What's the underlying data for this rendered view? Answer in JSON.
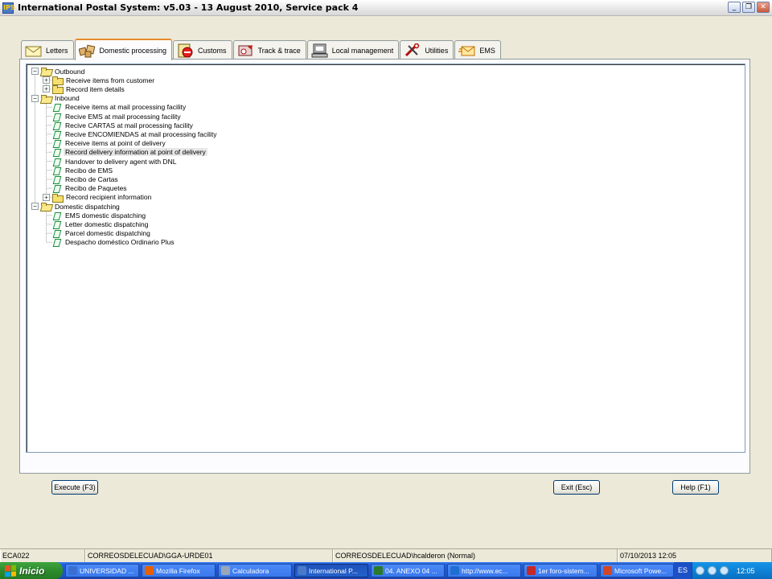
{
  "window": {
    "title": "International Postal System: v5.03 - 13 August 2010, Service pack 4",
    "app_icon_text": "IPS",
    "minimize": "_",
    "restore": "❐",
    "close": "✕"
  },
  "tabs": [
    {
      "label": "Letters",
      "icon": "envelope-icon"
    },
    {
      "label": "Domestic processing",
      "icon": "parcels-icon"
    },
    {
      "label": "Customs",
      "icon": "customs-icon"
    },
    {
      "label": "Track & trace",
      "icon": "track-icon"
    },
    {
      "label": "Local management",
      "icon": "computer-icon"
    },
    {
      "label": "Utilities",
      "icon": "tools-icon"
    },
    {
      "label": "EMS",
      "icon": "ems-icon"
    }
  ],
  "active_tab": "Domestic processing",
  "tree": {
    "nodes": [
      {
        "label": "Outbound",
        "level": 0,
        "type": "folder",
        "expander": "−"
      },
      {
        "label": "Receive items from customer",
        "level": 1,
        "type": "folder",
        "expander": "+"
      },
      {
        "label": "Record item details",
        "level": 1,
        "type": "folder",
        "expander": "+"
      },
      {
        "label": "Inbound",
        "level": 0,
        "type": "folder",
        "expander": "−"
      },
      {
        "label": "Receive items at mail processing facility",
        "level": 1,
        "type": "leaf"
      },
      {
        "label": "Recive EMS at mail processing facility",
        "level": 1,
        "type": "leaf"
      },
      {
        "label": "Recive CARTAS at mail processing facility",
        "level": 1,
        "type": "leaf"
      },
      {
        "label": "Recive ENCOMIENDAS at mail processing facility",
        "level": 1,
        "type": "leaf"
      },
      {
        "label": "Receive items at point of delivery",
        "level": 1,
        "type": "leaf"
      },
      {
        "label": "Record delivery information at point of delivery",
        "level": 1,
        "type": "leaf",
        "selected": true
      },
      {
        "label": "Handover to delivery agent with DNL",
        "level": 1,
        "type": "leaf"
      },
      {
        "label": "Recibo de EMS",
        "level": 1,
        "type": "leaf"
      },
      {
        "label": "Recibo de Cartas",
        "level": 1,
        "type": "leaf"
      },
      {
        "label": "Recibo de Paquetes",
        "level": 1,
        "type": "leaf"
      },
      {
        "label": "Record recipient information",
        "level": 1,
        "type": "folder",
        "expander": "+"
      },
      {
        "label": "Domestic dispatching",
        "level": 0,
        "type": "folder",
        "expander": "−"
      },
      {
        "label": "EMS domestic dispatching",
        "level": 1,
        "type": "leaf"
      },
      {
        "label": "Letter domestic dispatching",
        "level": 1,
        "type": "leaf"
      },
      {
        "label": "Parcel domestic dispatching",
        "level": 1,
        "type": "leaf"
      },
      {
        "label": "Despacho doméstico Ordinario Plus",
        "level": 1,
        "type": "leaf"
      }
    ]
  },
  "buttons": {
    "execute": "Execute (F3)",
    "exit": "Exit (Esc)",
    "help": "Help (F1)"
  },
  "status": {
    "code": "ECA022",
    "office": "CORREOSDELECUAD\\GGA-URDE01",
    "user": "CORREOSDELECUAD\\hcalderon (Normal)",
    "datetime": "07/10/2013 12:05"
  },
  "taskbar": {
    "start_label": "Inicio",
    "items": [
      {
        "label": "UNIVERSIDAD ...",
        "color": "#3a6fd0"
      },
      {
        "label": "Mozilla Firefox",
        "color": "#e66000"
      },
      {
        "label": "Calculadora",
        "color": "#9aa7b8"
      },
      {
        "label": "International P...",
        "color": "#4a7ac9",
        "active": true
      },
      {
        "label": "04. ANEXO 04 ...",
        "color": "#2b7a2b"
      },
      {
        "label": "http://www.ec...",
        "color": "#1f6fd0"
      },
      {
        "label": "1er foro-sistem...",
        "color": "#c62828"
      },
      {
        "label": "Microsoft Powe...",
        "color": "#d24726"
      }
    ],
    "language": "ES",
    "clock": "12:05"
  }
}
